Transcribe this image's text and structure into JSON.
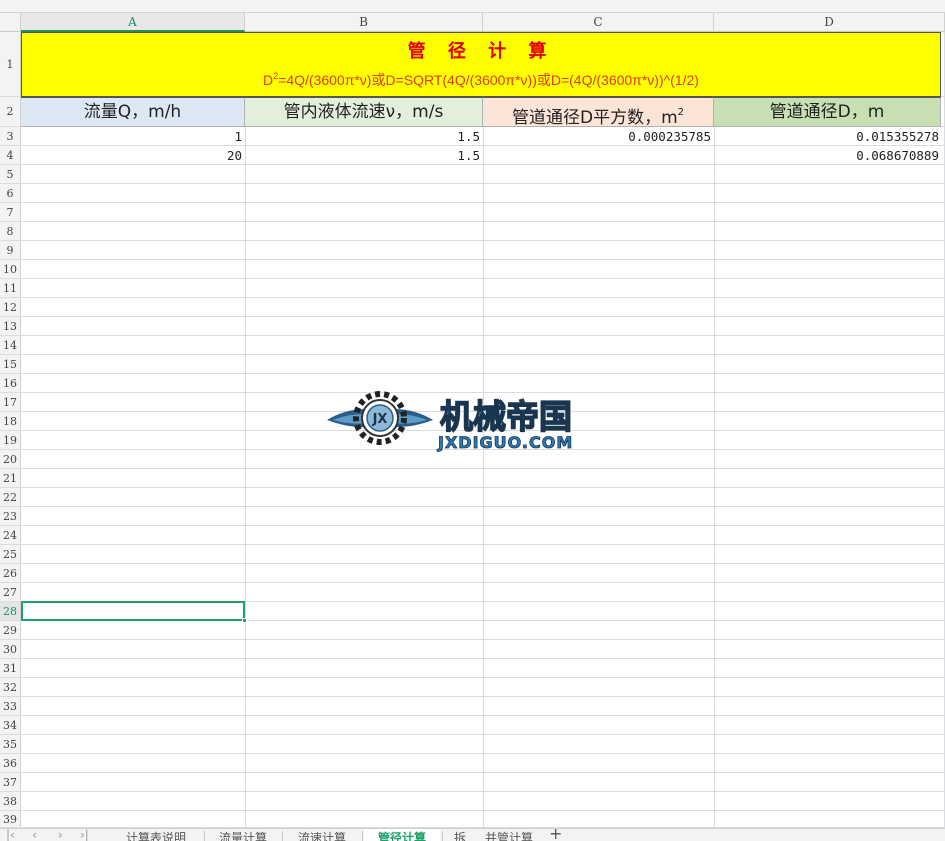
{
  "columns": [
    "A",
    "B",
    "C",
    "D"
  ],
  "rows": [
    "1",
    "2",
    "3",
    "4",
    "5",
    "6",
    "7",
    "8",
    "9",
    "10",
    "11",
    "12",
    "13",
    "14",
    "15",
    "16",
    "17",
    "18",
    "19",
    "20",
    "21",
    "22",
    "23",
    "24",
    "25",
    "26",
    "27",
    "28",
    "29",
    "30",
    "31",
    "32",
    "33",
    "34",
    "35",
    "36",
    "37",
    "38",
    "39"
  ],
  "active_row": "28",
  "active_column": "A",
  "title": {
    "main": "管 径 计 算",
    "formula_prefix": "D",
    "formula_sup": "2",
    "formula_rest": "=4Q/(3600π*ν)或D=SQRT(4Q/(3600π*ν))或D=(4Q/(3600π*ν))^(1/2)"
  },
  "headers": [
    {
      "text": "流量Q，m/h",
      "sup": "",
      "suffix": "",
      "color": "#dce9f5"
    },
    {
      "text": "管内液体流速ν，m/s",
      "sup": "",
      "suffix": "",
      "color": "#e2efda"
    },
    {
      "text": "管道通径D平方数，m",
      "sup": "2",
      "suffix": "",
      "color": "#fce4d6"
    },
    {
      "text": "管道通径D，m",
      "sup": "",
      "suffix": "",
      "color": "#c6e0b4"
    }
  ],
  "data_rows": [
    {
      "A": "1",
      "B": "1.5",
      "C": "0.000235785",
      "D": "0.015355278"
    },
    {
      "A": "20",
      "B": "1.5",
      "C": "",
      "D": "0.068670889"
    }
  ],
  "watermark": {
    "cn": "机械帝国",
    "en": "JXDIGUO.COM",
    "emblem": "JX"
  },
  "sheet_tabs": [
    {
      "label": "计算表说明",
      "active": false
    },
    {
      "label": "流量计算",
      "active": false
    },
    {
      "label": "流速计算",
      "active": false
    },
    {
      "label": "管径计算",
      "active": true
    },
    {
      "label": "拆",
      "active": false
    },
    {
      "label": "并管计算",
      "active": false
    }
  ],
  "nav_icons": [
    "first-sheet-icon",
    "prev-sheet-icon",
    "next-sheet-icon",
    "last-sheet-icon"
  ],
  "add_sheet_label": "+"
}
